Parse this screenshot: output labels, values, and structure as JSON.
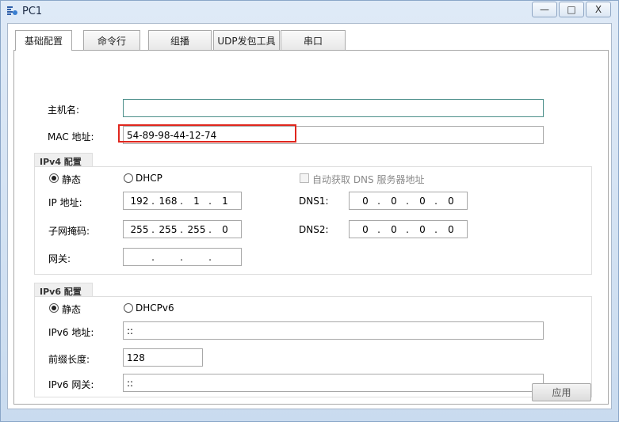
{
  "window": {
    "title": "PC1",
    "minimize_label": "—",
    "maximize_label": "□",
    "close_label": "X"
  },
  "tabs": [
    {
      "label": "基础配置",
      "active": true
    },
    {
      "label": "命令行",
      "active": false
    },
    {
      "label": "组播",
      "active": false
    },
    {
      "label": "UDP发包工具",
      "active": false
    },
    {
      "label": "串口",
      "active": false
    }
  ],
  "basic": {
    "hostname_label": "主机名:",
    "hostname_value": "",
    "mac_label": "MAC 地址:",
    "mac_value": "54-89-98-44-12-74"
  },
  "ipv4": {
    "group_label": "IPv4 配置",
    "static_label": "静态",
    "dhcp_label": "DHCP",
    "selected": "static",
    "auto_dns_label": "自动获取 DNS 服务器地址",
    "ip_label": "IP 地址:",
    "ip_octets": [
      "192",
      "168",
      "1",
      "1"
    ],
    "mask_label": "子网掩码:",
    "mask_octets": [
      "255",
      "255",
      "255",
      "0"
    ],
    "gateway_label": "网关:",
    "gateway_octets": [
      "",
      "",
      "",
      ""
    ],
    "dns1_label": "DNS1:",
    "dns1_octets": [
      "0",
      "0",
      "0",
      "0"
    ],
    "dns2_label": "DNS2:",
    "dns2_octets": [
      "0",
      "0",
      "0",
      "0"
    ]
  },
  "ipv6": {
    "group_label": "IPv6 配置",
    "static_label": "静态",
    "dhcp_label": "DHCPv6",
    "selected": "static",
    "addr_label": "IPv6 地址:",
    "addr_value": "::",
    "prefix_label": "前缀长度:",
    "prefix_value": "128",
    "gateway_label": "IPv6 网关:",
    "gateway_value": "::"
  },
  "apply_label": "应用",
  "colors": {
    "highlight": "#e0261d",
    "focus_border": "#4c8f8a"
  }
}
